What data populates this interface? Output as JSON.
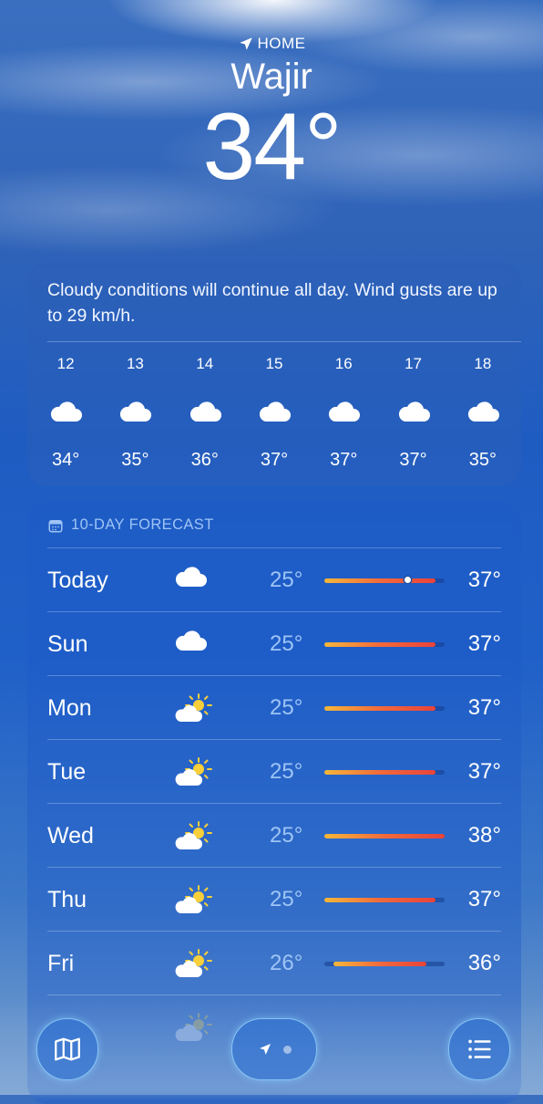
{
  "header": {
    "location_label": "HOME",
    "city": "Wajir",
    "temperature": "34°"
  },
  "hourly": {
    "summary": "Cloudy conditions will continue all day. Wind gusts are up to 29 km/h.",
    "hours": [
      {
        "hour": "12",
        "icon": "cloud-icon",
        "temp": "34°"
      },
      {
        "hour": "13",
        "icon": "cloud-icon",
        "temp": "35°"
      },
      {
        "hour": "14",
        "icon": "cloud-icon",
        "temp": "36°"
      },
      {
        "hour": "15",
        "icon": "cloud-icon",
        "temp": "37°"
      },
      {
        "hour": "16",
        "icon": "cloud-icon",
        "temp": "37°"
      },
      {
        "hour": "17",
        "icon": "cloud-icon",
        "temp": "37°"
      },
      {
        "hour": "18",
        "icon": "cloud-icon",
        "temp": "35°"
      }
    ]
  },
  "forecast": {
    "title": "10-DAY FORECAST",
    "range_min": 25,
    "range_max": 38,
    "days": [
      {
        "day": "Today",
        "icon": "cloud-icon",
        "low": "25°",
        "high": "37°",
        "low_val": 25,
        "high_val": 37,
        "current_val": 34
      },
      {
        "day": "Sun",
        "icon": "cloud-icon",
        "low": "25°",
        "high": "37°",
        "low_val": 25,
        "high_val": 37
      },
      {
        "day": "Mon",
        "icon": "partly-sunny-icon",
        "low": "25°",
        "high": "37°",
        "low_val": 25,
        "high_val": 37
      },
      {
        "day": "Tue",
        "icon": "partly-sunny-icon",
        "low": "25°",
        "high": "37°",
        "low_val": 25,
        "high_val": 37
      },
      {
        "day": "Wed",
        "icon": "partly-sunny-icon",
        "low": "25°",
        "high": "38°",
        "low_val": 25,
        "high_val": 38
      },
      {
        "day": "Thu",
        "icon": "partly-sunny-icon",
        "low": "25°",
        "high": "37°",
        "low_val": 25,
        "high_val": 37
      },
      {
        "day": "Fri",
        "icon": "partly-sunny-icon",
        "low": "26°",
        "high": "36°",
        "low_val": 26,
        "high_val": 36
      }
    ]
  },
  "colors": {
    "accent_text": "#9ec4f5",
    "bar_start": "#f5b73a",
    "bar_end": "#e9433b"
  },
  "toolbar": {
    "map_icon": "map-icon",
    "location_icon": "location-arrow-icon",
    "list_icon": "list-icon"
  }
}
